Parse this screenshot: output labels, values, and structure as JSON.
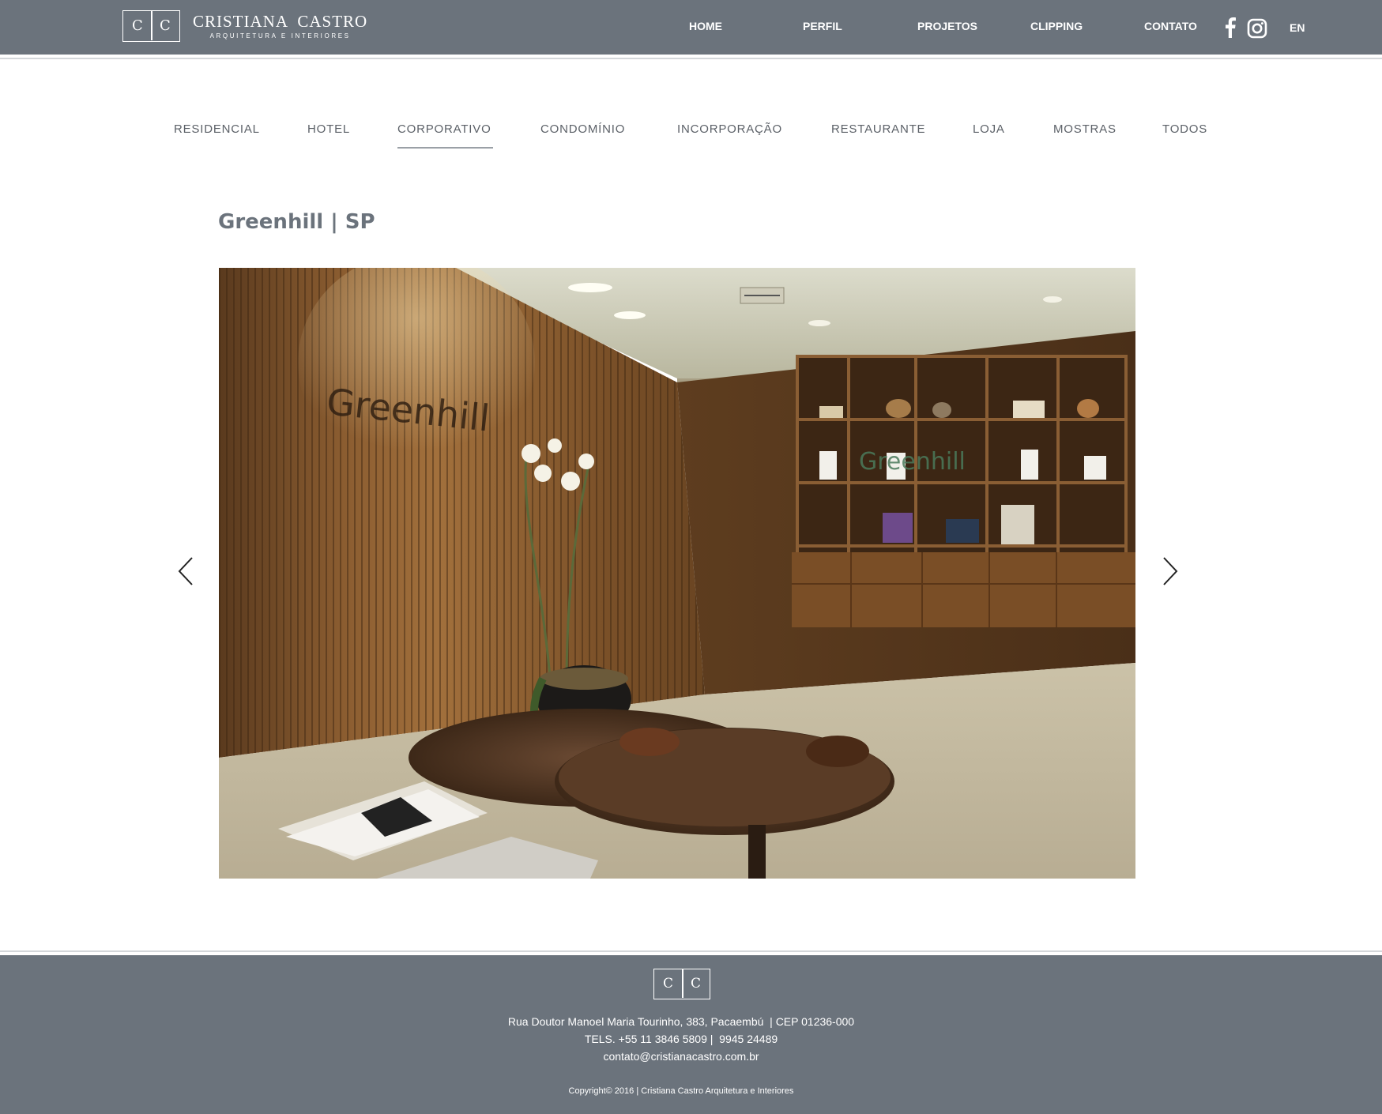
{
  "header": {
    "logo": {
      "letters": [
        "C",
        "C"
      ],
      "name": "CRISTIANA  CASTRO",
      "tagline": "ARQUITETURA E INTERIORES"
    },
    "nav": [
      "HOME",
      "PERFIL",
      "PROJETOS",
      "CLIPPING",
      "CONTATO"
    ],
    "social": [
      "facebook-icon",
      "instagram-icon"
    ],
    "language": "EN"
  },
  "categories": {
    "items": [
      "RESIDENCIAL",
      "HOTEL",
      "CORPORATIVO",
      "CONDOMÍNIO",
      "INCORPORAÇÃO",
      "RESTAURANTE",
      "LOJA",
      "MOSTRAS",
      "TODOS"
    ],
    "active": "CORPORATIVO"
  },
  "project": {
    "title": "Greenhill | SP",
    "photo": {
      "wall_lettering": "Greenhill",
      "shelf_lettering": "Greenhill"
    }
  },
  "footer": {
    "logo_letters": [
      "C",
      "C"
    ],
    "address": "Rua Doutor Manoel Maria Tourinho, 383, Pacaembú  | CEP 01236-000",
    "phones": "TELS. +55 11 3846 5809 |  9945 24489",
    "email": "contato@cristianacastro.com.br",
    "copyright": "Copyright© 2016 | Cristiana Castro Arquitetura e Interiores"
  },
  "colors": {
    "header_bg": "#6b737c",
    "footer_bg": "#6b737c",
    "text": "#5c6168"
  }
}
